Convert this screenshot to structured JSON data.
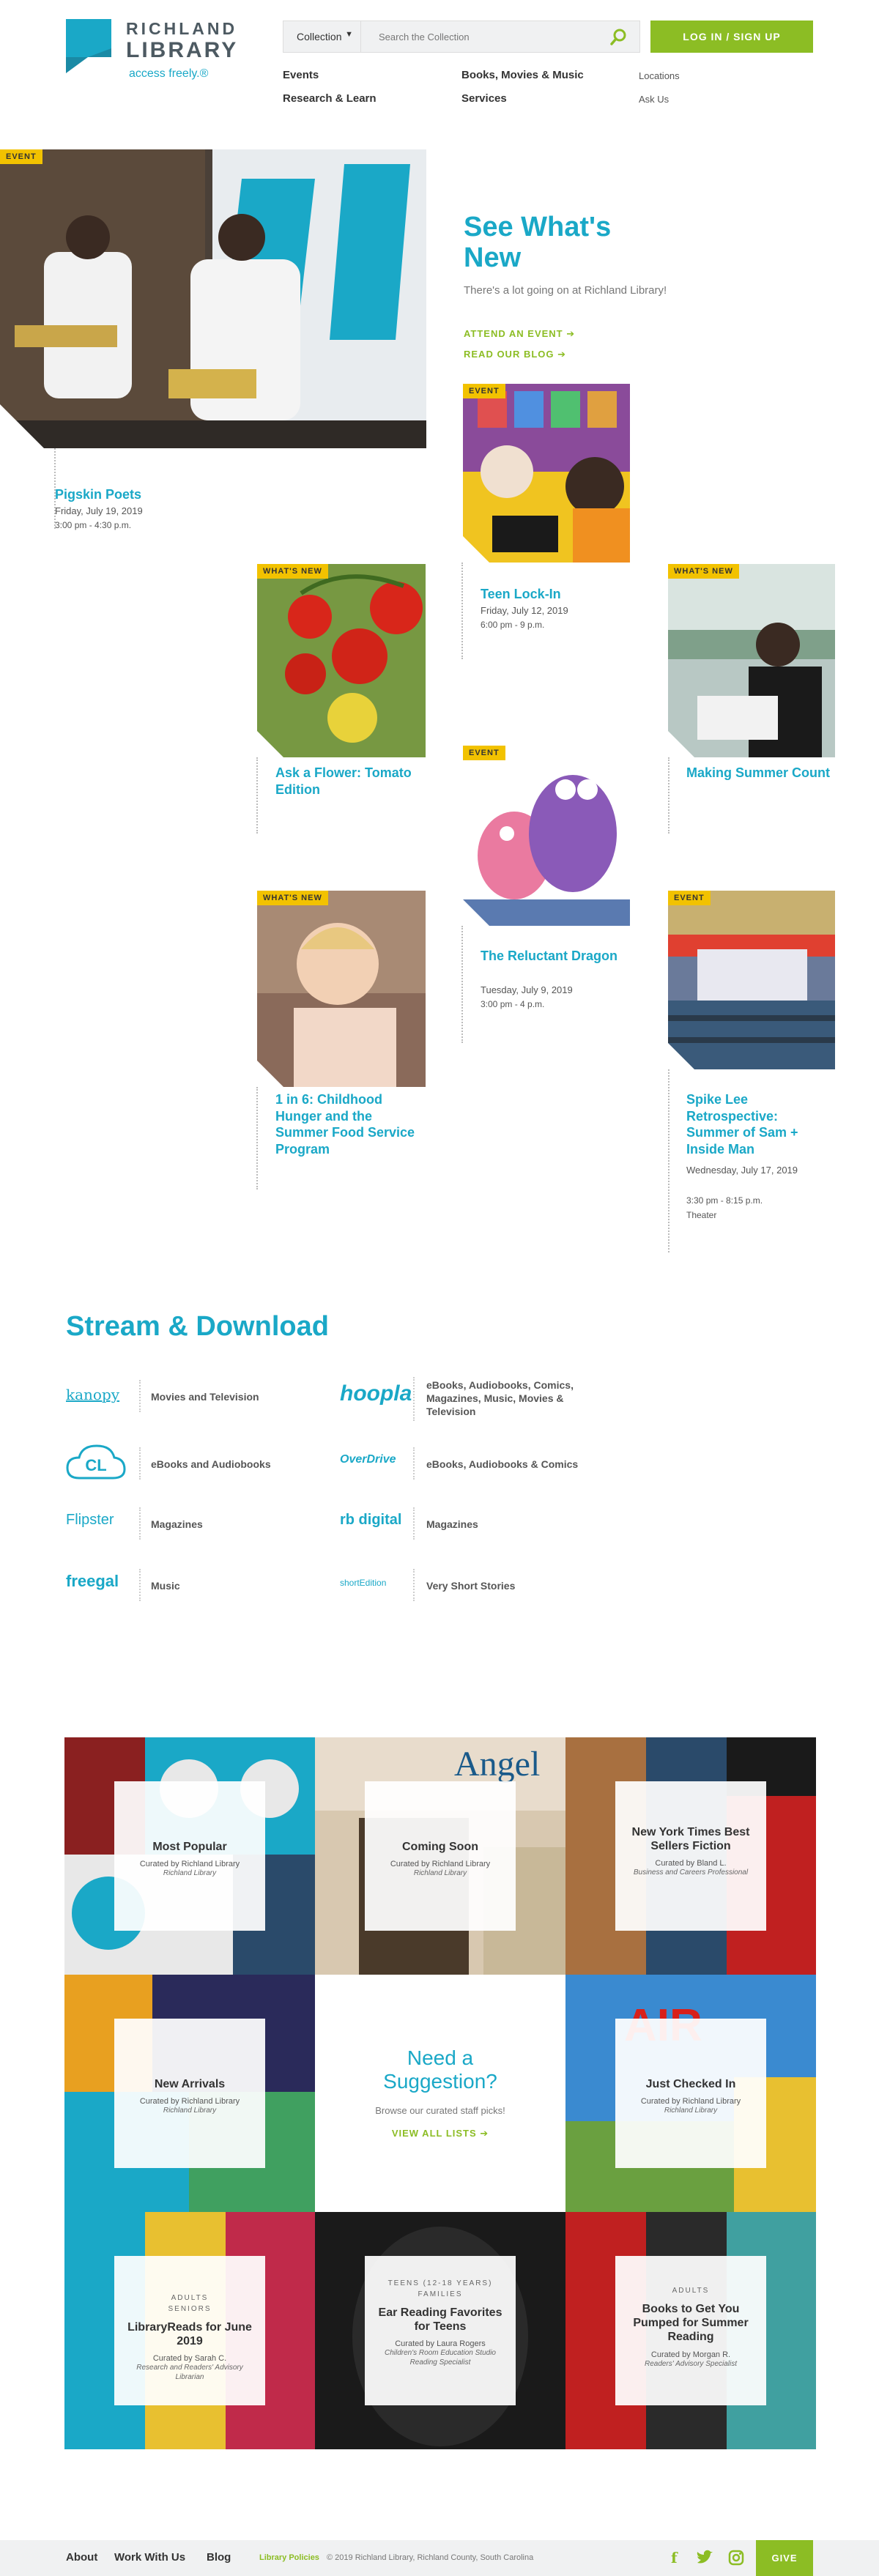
{
  "header": {
    "logo_line1": "RICHLAND",
    "logo_line2": "LIBRARY",
    "logo_tagline": "access freely.®",
    "search_select": "Collection",
    "search_placeholder": "Search the Collection",
    "login_label": "LOG IN / SIGN UP",
    "nav": [
      "Events",
      "Research & Learn",
      "Books, Movies & Music",
      "Services",
      "Locations",
      "Ask Us"
    ]
  },
  "hero": {
    "title": "See What's New",
    "subtitle": "There's a lot going on at Richland Library!",
    "link_event": "ATTEND AN EVENT ➔",
    "link_blog": "READ OUR BLOG ➔"
  },
  "feed": [
    {
      "tag": "EVENT",
      "title": "Pigskin Poets",
      "date": "Friday, July 19, 2019",
      "time": "3:00 pm - 4:30 p.m."
    },
    {
      "tag": "EVENT",
      "title": "Teen Lock-In",
      "date": "Friday, July 12, 2019",
      "time": "6:00 pm - 9 p.m."
    },
    {
      "tag": "WHAT'S NEW",
      "title": "Ask a Flower: Tomato Edition"
    },
    {
      "tag": "WHAT'S NEW",
      "title": "Making Summer Count"
    },
    {
      "tag": "EVENT",
      "title": "The Reluctant Dragon",
      "date": "Tuesday, July 9, 2019",
      "time": "3:00 pm - 4 p.m."
    },
    {
      "tag": "WHAT'S NEW",
      "title": "1 in 6: Childhood Hunger and the Summer Food Service Program"
    },
    {
      "tag": "EVENT",
      "title": "Spike Lee Retrospective: Summer of Sam + Inside Man",
      "date": "Wednesday, July 17, 2019",
      "time": "3:30 pm - 8:15 p.m.",
      "place": "Theater"
    }
  ],
  "stream": {
    "title": "Stream & Download",
    "services": [
      {
        "logo": "kanopy",
        "label": "Movies and Television"
      },
      {
        "logo": "hoopla",
        "label": "eBooks, Audiobooks, Comics, Magazines, Music, Movies & Television"
      },
      {
        "logo": "CL",
        "label": "eBooks and Audiobooks"
      },
      {
        "logo": "OverDrive",
        "label": "eBooks, Audiobooks & Comics"
      },
      {
        "logo": "Flipster",
        "label": "Magazines"
      },
      {
        "logo": "rb digital",
        "label": "Magazines"
      },
      {
        "logo": "freegal",
        "label": "Music"
      },
      {
        "logo": "shortEdition",
        "label": "Very Short Stories"
      }
    ]
  },
  "lists": {
    "suggestion_title": "Need a Suggestion?",
    "suggestion_sub": "Browse our curated staff picks!",
    "suggestion_link": "VIEW ALL LISTS ➔",
    "cards": [
      {
        "title": "Most Popular",
        "curator": "Curated by Richland Library",
        "role": "Richland Library"
      },
      {
        "title": "Coming Soon",
        "curator": "Curated by Richland Library",
        "role": "Richland Library"
      },
      {
        "title": "New York Times Best Sellers Fiction",
        "curator": "Curated by Bland L.",
        "role": "Business and Careers Professional"
      },
      {
        "title": "New Arrivals",
        "curator": "Curated by Richland Library",
        "role": "Richland Library"
      },
      {
        "title": "Just Checked In",
        "curator": "Curated by Richland Library",
        "role": "Richland Library"
      },
      {
        "category": "ADULTS\nSENIORS",
        "title": "LibraryReads for June 2019",
        "curator": "Curated by Sarah C.",
        "role": "Research and Readers' Advisory Librarian"
      },
      {
        "category": "TEENS (12-18 YEARS)\nFAMILIES",
        "title": "Ear Reading Favorites for Teens",
        "curator": "Curated by Laura Rogers",
        "role": "Children's Room Education Studio Reading Specialist"
      },
      {
        "category": "ADULTS",
        "title": "Books to Get You Pumped for Summer Reading",
        "curator": "Curated by Morgan R.",
        "role": "Readers' Advisory Specialist"
      }
    ]
  },
  "footer": {
    "about": "About",
    "work": "Work With Us",
    "blog": "Blog",
    "policies": "Library Policies",
    "copyright": "© 2019 Richland Library, Richland County, South Carolina",
    "give": "GIVE"
  },
  "colors": {
    "teal": "#1aa8c7",
    "green": "#8cbd24",
    "yellow": "#f2c200"
  }
}
